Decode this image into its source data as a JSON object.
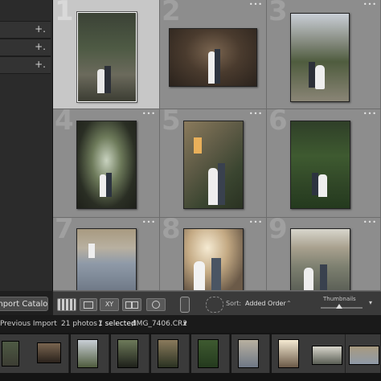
{
  "left_panel": {
    "rows": [
      "",
      "",
      ""
    ],
    "plus_glyph": "+.",
    "import_label": "Import Catalog"
  },
  "grid": {
    "cells": [
      {
        "number": "1",
        "selected": true,
        "dots": "•••"
      },
      {
        "number": "2",
        "selected": false,
        "dots": "•••"
      },
      {
        "number": "3",
        "selected": false,
        "dots": "•••"
      },
      {
        "number": "4",
        "selected": false,
        "dots": "•••"
      },
      {
        "number": "5",
        "selected": false,
        "dots": "•••"
      },
      {
        "number": "6",
        "selected": false,
        "dots": "•••"
      },
      {
        "number": "7",
        "selected": false,
        "dots": "•••"
      },
      {
        "number": "8",
        "selected": false,
        "dots": "•••"
      },
      {
        "number": "9",
        "selected": false,
        "dots": "•••"
      }
    ]
  },
  "toolbar": {
    "sort_label": "Sort:",
    "sort_value": "Added Order",
    "sort_arrow": "⌃",
    "thumbnails_label": "Thumbnails",
    "thumbnail_size": 0.45,
    "xy_label": "XY",
    "menu_arrow": "▾"
  },
  "filmbar": {
    "source": "Previous Import",
    "count": "21 photos /",
    "selected": "1 selected",
    "filename": "/IMG_7406.CR2",
    "dropdown": "▾"
  },
  "colors": {
    "grid_bg": "#8d8d8d",
    "selected_cell": "#c7c7c7",
    "panel": "#2b2b2b"
  }
}
